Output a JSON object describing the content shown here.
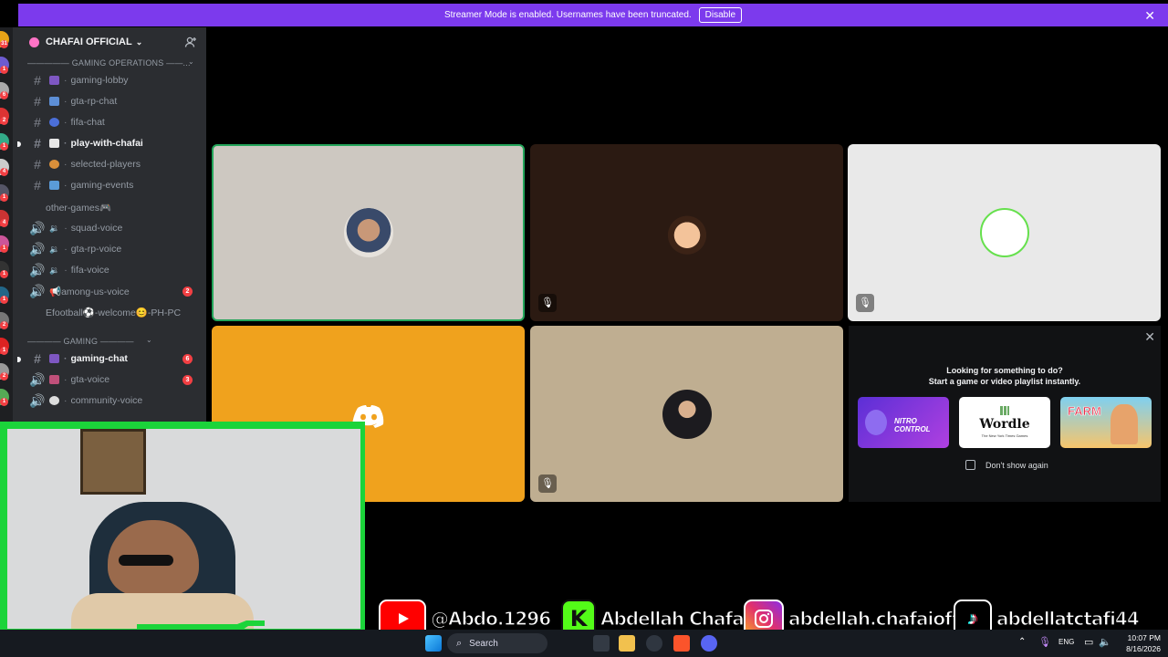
{
  "banner": {
    "text": "Streamer Mode is enabled. Usernames have been truncated.",
    "button": "Disable"
  },
  "server": {
    "name": "CHAFAI OFFICIAL"
  },
  "categories": [
    {
      "label": "————— GAMING OPERATIONS ——..."
    },
    {
      "label": "———— GAMING ————"
    }
  ],
  "channels": [
    {
      "label": "gaming-lobby"
    },
    {
      "label": "gta-rp-chat"
    },
    {
      "label": "fifa-chat"
    },
    {
      "label": "play-with-chafai"
    },
    {
      "label": "selected-players"
    },
    {
      "label": "gaming-events"
    },
    {
      "label": "other-games🎮"
    },
    {
      "label": "squad-voice"
    },
    {
      "label": "gta-rp-voice"
    },
    {
      "label": "fifa-voice"
    },
    {
      "label": "📢among-us-voice",
      "badge": "2"
    },
    {
      "label": "Efootball⚽-welcome😊-PH-PC"
    },
    {
      "label": "gaming-chat",
      "badge": "6"
    },
    {
      "label": "gta-voice",
      "badge": "3"
    },
    {
      "label": "community-voice"
    }
  ],
  "activity": {
    "line1": "Looking for something to do?",
    "line2": "Start a game or video playlist instantly.",
    "games": [
      "NITRO CONTROL",
      "Wordle",
      "FARM"
    ],
    "wordle_sub": "The New York Times Games",
    "dont_show": "Don't show again"
  },
  "social": {
    "youtube": "@Abdo.1296",
    "kick": "Abdellah Chafai",
    "instagram": "abdellah.chafaioffitid",
    "tiktok": "abdellatctafi44"
  },
  "taskbar": {
    "search": "Search",
    "lang": "ENG",
    "time": "10:07 PM",
    "date": "8/16/2026"
  },
  "rail_badges": [
    "31",
    "1",
    "6",
    "2",
    "1",
    "4",
    "1",
    "4",
    "1",
    "1",
    "1",
    "2",
    "1",
    "2",
    "1",
    "1"
  ],
  "colors": {
    "banner": "#7c3aed",
    "accent_green": "#23a55a",
    "discord_blurple": "#5865f2"
  }
}
